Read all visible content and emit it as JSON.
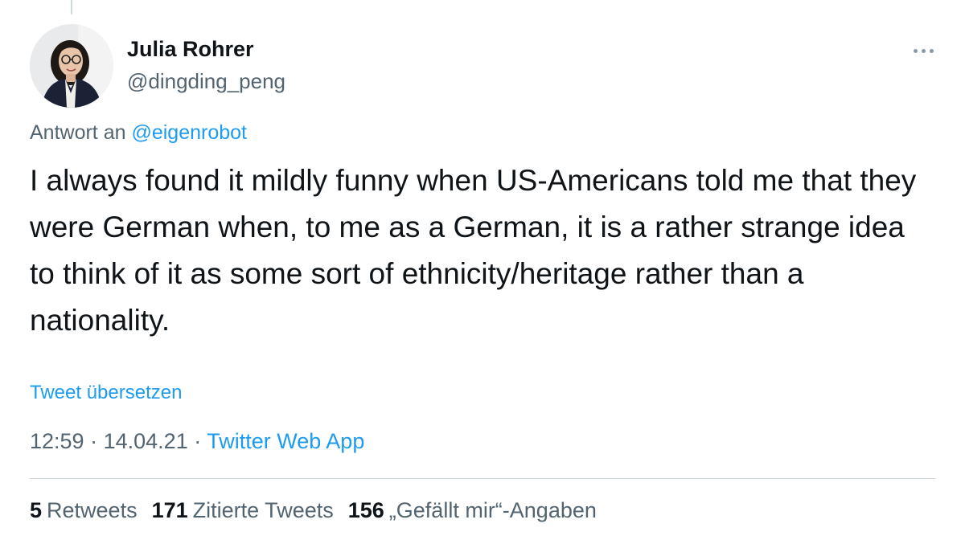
{
  "user": {
    "name": "Julia Rohrer",
    "handle": "@dingding_peng"
  },
  "reply": {
    "prefix": "Antwort an",
    "mention": "@eigenrobot"
  },
  "tweet": {
    "text": "I always found it mildly funny when US-Americans told me that they were German when, to me as a German, it is a rather strange idea to think of it as some sort of ethnicity/heritage rather than a nationality.",
    "translate_label": "Tweet übersetzen"
  },
  "meta": {
    "time": "12:59",
    "date": "14.04.21",
    "client": "Twitter Web App",
    "separator": "·"
  },
  "stats": {
    "retweets_count": "5",
    "retweets_label": "Retweets",
    "quotes_count": "171",
    "quotes_label": "Zitierte Tweets",
    "likes_count": "156",
    "likes_label": "„Gefällt mir“-Angaben"
  },
  "icons": {
    "more": "more-horizontal-icon"
  },
  "colors": {
    "link": "#1d9bf0",
    "secondary_text": "#536471",
    "primary_text": "#0f1419",
    "divider": "#cfd9de"
  }
}
